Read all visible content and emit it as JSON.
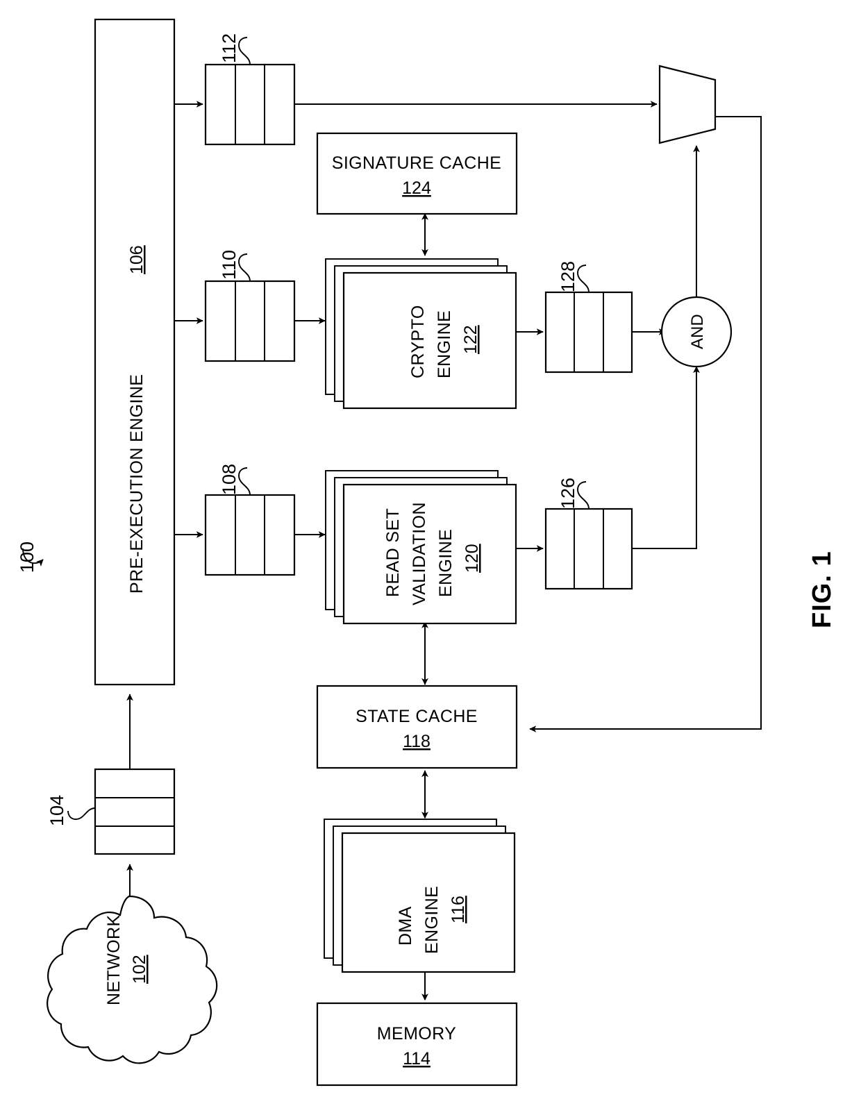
{
  "figure": {
    "label": "FIG. 1",
    "system_ref": "100"
  },
  "blocks": {
    "network": {
      "name": "NETWORK",
      "ref": "102",
      "shape": "cloud"
    },
    "nic_queue": {
      "name": "",
      "ref": "104",
      "shape": "queue",
      "cells": 3
    },
    "pre_execution_engine": {
      "name": "PRE-EXECUTION ENGINE",
      "ref": "106",
      "shape": "rect"
    },
    "queue_108": {
      "name": "",
      "ref": "108",
      "shape": "queue",
      "cells": 3
    },
    "queue_110": {
      "name": "",
      "ref": "110",
      "shape": "queue",
      "cells": 3
    },
    "queue_112": {
      "name": "",
      "ref": "112",
      "shape": "queue",
      "cells": 3
    },
    "memory": {
      "name": "MEMORY",
      "ref": "114",
      "shape": "rect"
    },
    "dma_engine": {
      "name": "DMA ENGINE",
      "ref": "116",
      "shape": "stacked-rect",
      "lines": [
        "DMA",
        "ENGINE"
      ]
    },
    "state_cache": {
      "name": "STATE CACHE",
      "ref": "118",
      "shape": "rect"
    },
    "read_set_validation_engine": {
      "name": "READ SET VALIDATION ENGINE",
      "ref": "120",
      "shape": "stacked-rect",
      "lines": [
        "READ SET",
        "VALIDATION",
        "ENGINE"
      ]
    },
    "crypto_engine": {
      "name": "CRYPTO ENGINE",
      "ref": "122",
      "shape": "stacked-rect",
      "lines": [
        "CRYPTO",
        "ENGINE"
      ]
    },
    "signature_cache": {
      "name": "SIGNATURE CACHE",
      "ref": "124",
      "shape": "rect"
    },
    "queue_126": {
      "name": "",
      "ref": "126",
      "shape": "queue",
      "cells": 3
    },
    "queue_128": {
      "name": "",
      "ref": "128",
      "shape": "queue",
      "cells": 3
    },
    "and_gate": {
      "name": "AND",
      "ref": "",
      "shape": "circle"
    },
    "mux": {
      "name": "",
      "ref": "",
      "shape": "trapezoid"
    }
  },
  "colors": {
    "line": "#000000",
    "fill": "#ffffff"
  }
}
